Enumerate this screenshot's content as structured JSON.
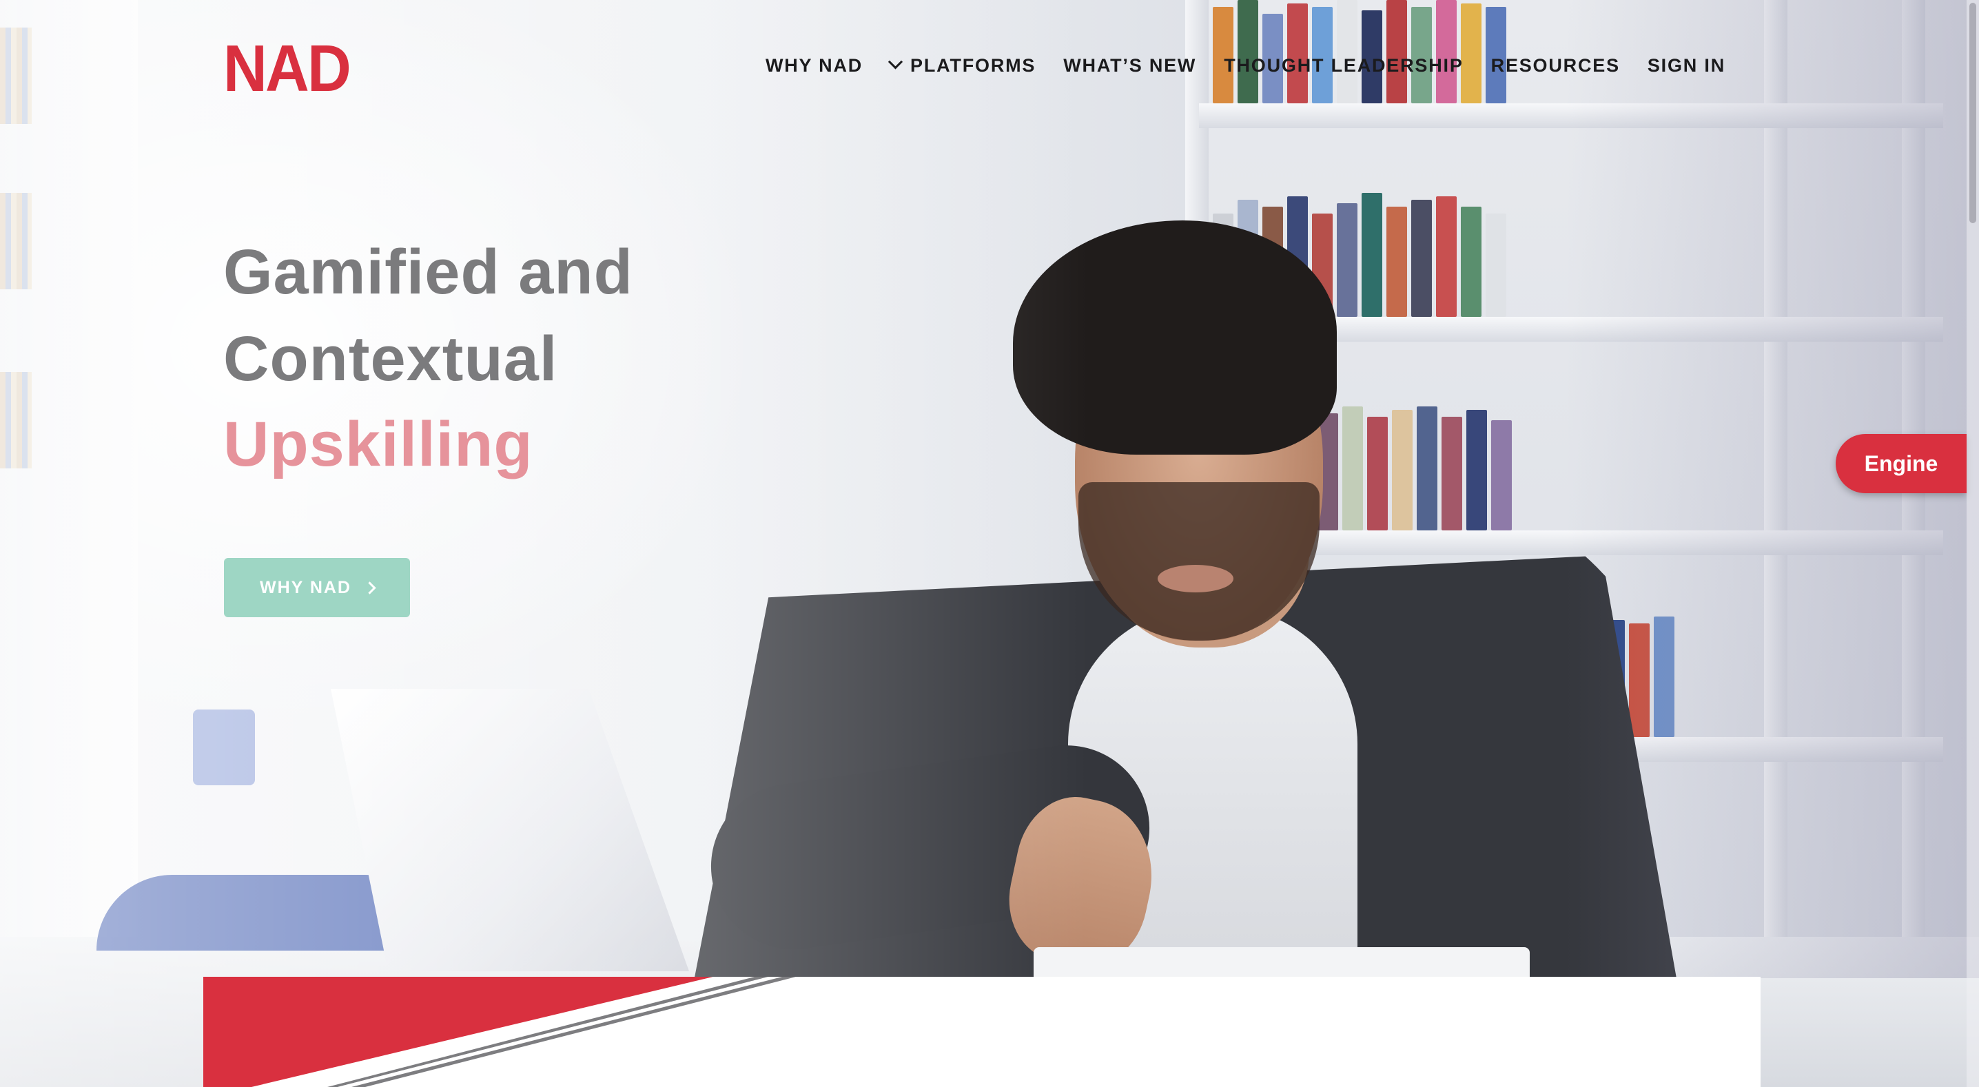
{
  "header": {
    "logo_text": "NAD",
    "nav": [
      {
        "label": "WHY NAD",
        "has_dropdown": false
      },
      {
        "label": "PLATFORMS",
        "has_dropdown": true
      },
      {
        "label": "WHAT’S NEW",
        "has_dropdown": false
      },
      {
        "label": "THOUGHT LEADERSHIP",
        "has_dropdown": false
      },
      {
        "label": "RESOURCES",
        "has_dropdown": false
      },
      {
        "label": "SIGN IN",
        "has_dropdown": false
      }
    ]
  },
  "hero": {
    "line1": "Gamified and",
    "line2": "Contextual",
    "line3": "Upskilling",
    "cta_label": "WHY NAD"
  },
  "side_tab": {
    "label": "Engine"
  },
  "colors": {
    "brand_red": "#d9303f",
    "heading_gray": "#7b7b7d",
    "accent_pink": "#e6939b",
    "cta_mint": "#9ed6c4"
  },
  "icons": {
    "dropdown": "chevron-down-icon",
    "cta_arrow": "chevron-right-icon"
  }
}
